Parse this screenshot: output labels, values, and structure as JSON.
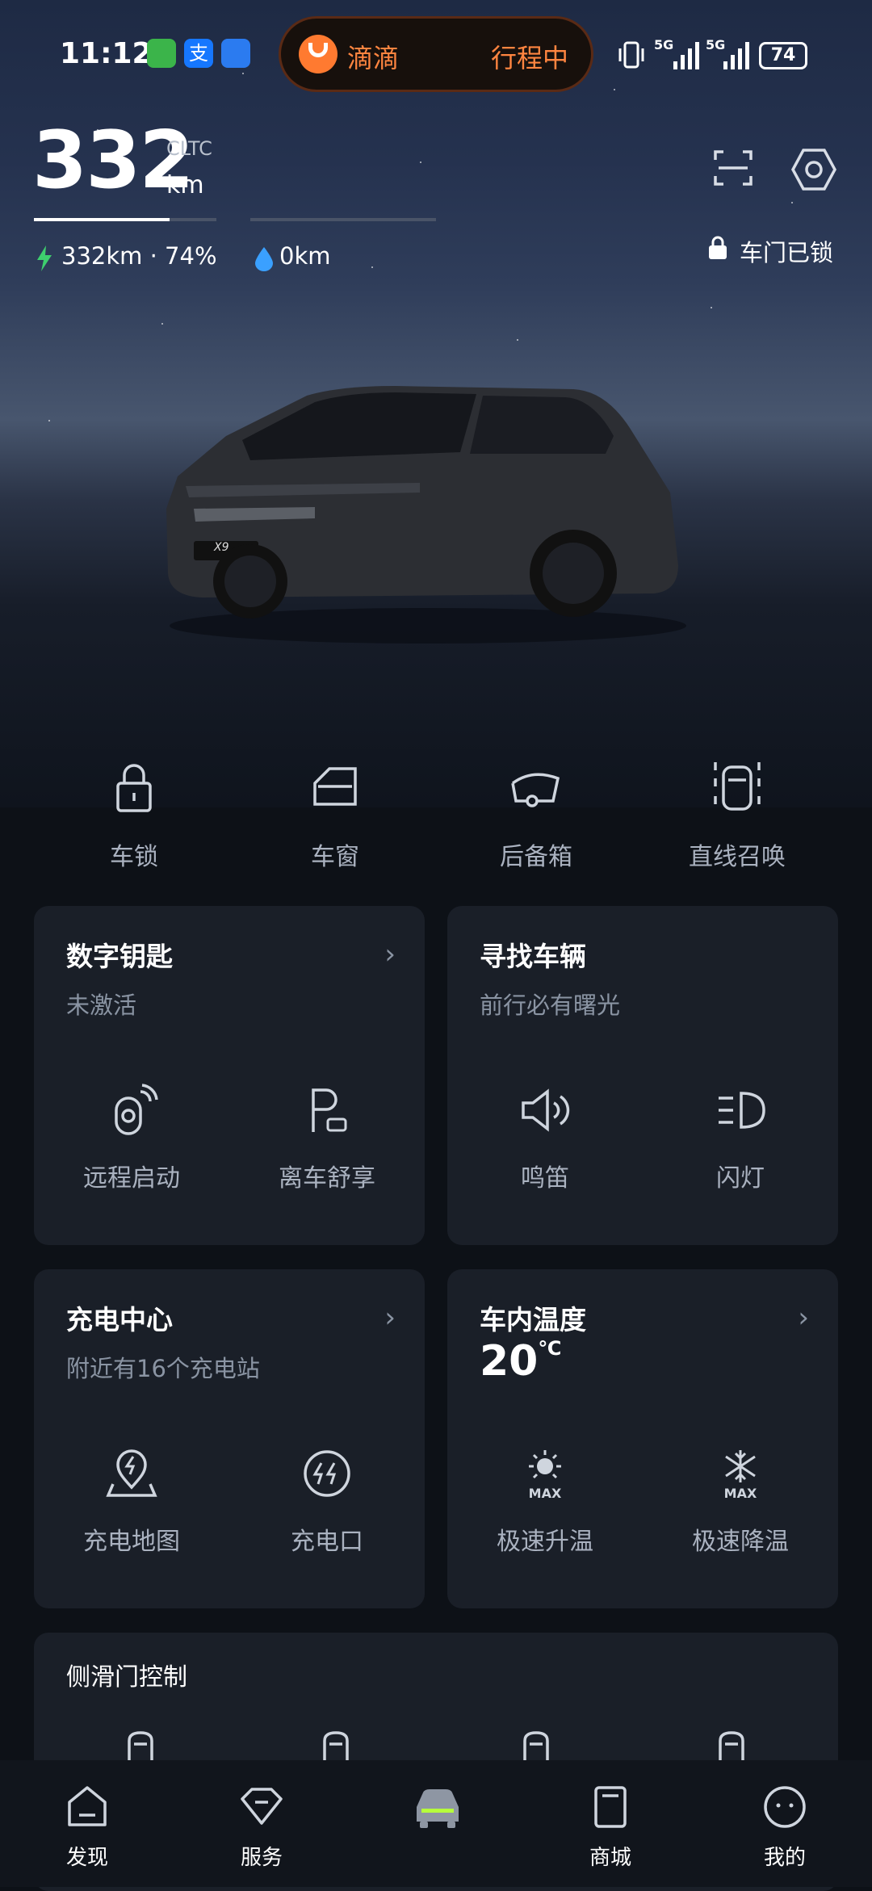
{
  "status_bar": {
    "time": "11:12",
    "live_activity": {
      "app": "滴滴",
      "status": "行程中"
    },
    "signal_labels": [
      "5G",
      "5G"
    ],
    "battery": "74"
  },
  "vehicle": {
    "range_value": "332",
    "range_standard": "CLTC",
    "range_unit": "km",
    "ev_range": "332km · 74%",
    "fuel_range": "0km",
    "lock_status": "车门已锁",
    "model_badge": "X9"
  },
  "quick_actions": [
    {
      "label": "车锁",
      "icon": "lock-icon"
    },
    {
      "label": "车窗",
      "icon": "window-icon"
    },
    {
      "label": "后备箱",
      "icon": "trunk-icon"
    },
    {
      "label": "直线召唤",
      "icon": "summon-icon"
    }
  ],
  "cards": {
    "digital_key": {
      "title": "数字钥匙",
      "subtitle": "未激活",
      "buttons": [
        "远程启动",
        "离车舒享"
      ]
    },
    "find_car": {
      "title": "寻找车辆",
      "subtitle": "前行必有曙光",
      "buttons": [
        "鸣笛",
        "闪灯"
      ]
    },
    "charging": {
      "title": "充电中心",
      "subtitle": "附近有16个充电站",
      "buttons": [
        "充电地图",
        "充电口"
      ]
    },
    "cabin_temp": {
      "title": "车内温度",
      "temperature": "20",
      "unit": "℃",
      "buttons": [
        "极速升温",
        "极速降温"
      ],
      "max_label": "MAX"
    },
    "slide_door": {
      "title": "侧滑门控制"
    }
  },
  "bottom_nav": [
    {
      "label": "发现",
      "icon": "discover-icon"
    },
    {
      "label": "服务",
      "icon": "service-icon"
    },
    {
      "label": "",
      "icon": "car-icon",
      "active": true
    },
    {
      "label": "商城",
      "icon": "mall-icon"
    },
    {
      "label": "我的",
      "icon": "profile-icon"
    }
  ],
  "colors": {
    "accent": "#3ecf6e",
    "fuel": "#3aa0ff",
    "didi": "#ff8540",
    "active_nav": "#b6ff3c"
  }
}
